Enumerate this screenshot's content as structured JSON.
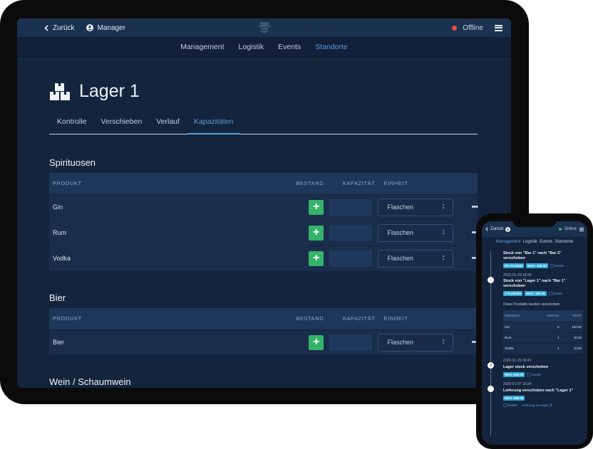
{
  "tablet": {
    "topbar": {
      "back_label": "Zurück",
      "user_label": "Manager",
      "status_label": "Offline"
    },
    "nav": [
      "Management",
      "Logistik",
      "Events",
      "Standorte"
    ],
    "nav_active": 3,
    "page_title": "Lager 1",
    "tabs": [
      "Kontrolle",
      "Verschieben",
      "Verlauf",
      "Kapazitäten"
    ],
    "tab_active": 3,
    "columns": {
      "product": "PRODUKT",
      "stock": "BESTAND",
      "capacity": "KAPAZITÄT",
      "unit": "EINHEIT"
    },
    "sections": [
      {
        "title": "Spirituosen",
        "rows": [
          {
            "product": "Gin",
            "unit": "Flaschen"
          },
          {
            "product": "Rum",
            "unit": "Flaschen"
          },
          {
            "product": "Vodka",
            "unit": "Flaschen"
          }
        ]
      },
      {
        "title": "Bier",
        "rows": [
          {
            "product": "Bier",
            "unit": "Flaschen"
          }
        ]
      },
      {
        "title": "Wein / Schaumwein",
        "rows": []
      }
    ],
    "more_symbol": "•••",
    "plus_symbol": "+"
  },
  "phone": {
    "topbar": {
      "back_label": "Zurück",
      "status_label": "Online"
    },
    "nav": [
      "Management",
      "Logistik",
      "Events",
      "Standorte"
    ],
    "events": [
      {
        "date": "",
        "title": "Stock von \"Bar 1\" nach \"Bar 2\" verschoben",
        "badges": [
          "Ein Produkt",
          "Wert: 150.00"
        ],
        "link": "Details"
      },
      {
        "date": "2020-01-20 18:39",
        "title": "Stock von \"Lager 1\" nach \"Bar 1\" verschoben",
        "badges": [
          "3 Produkte",
          "Wert: 180.00"
        ],
        "link": "Details"
      }
    ],
    "moved_note": "Diese Produkte wurden verschoben:",
    "mini_table": {
      "headers": [
        "PRODUKT",
        "ANZAHL",
        "WERT"
      ],
      "rows": [
        [
          "Gin",
          "6",
          "150.00"
        ],
        [
          "Rum",
          "1",
          "20.00"
        ],
        [
          "Vodka",
          "1",
          "20.00"
        ]
      ]
    },
    "events2": [
      {
        "date": "2020-01-15 09:47",
        "title": "Lager stock verschoben",
        "badges": [
          "Wert: 540.00"
        ],
        "link": "Details",
        "dot": "2"
      },
      {
        "date": "2020-01-07 16:34",
        "title": "Lieferung verschoben nach \"Lager 1\"",
        "badges": [
          "Wert: 558.00"
        ],
        "link": "Details",
        "link2": "Lieferung anzeigen"
      }
    ]
  },
  "colors": {
    "accent": "#5b9be0",
    "success": "#35b36a",
    "info": "#2ea9d7",
    "offline": "#e8533f",
    "background": "#14243d"
  }
}
